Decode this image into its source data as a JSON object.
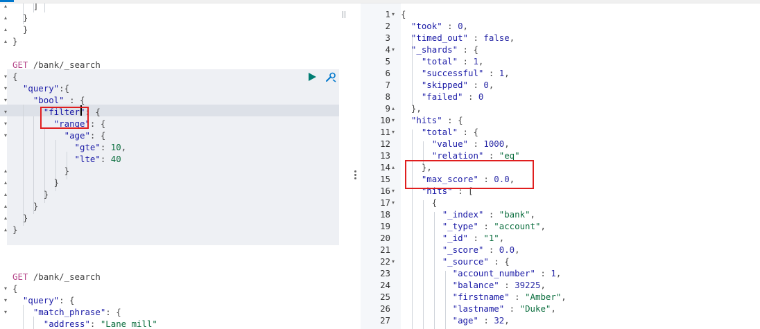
{
  "left_editor": {
    "lines": [
      {
        "fold": "▴",
        "parts": [
          [
            "",
            "    ]"
          ]
        ]
      },
      {
        "fold": "▴",
        "parts": [
          [
            "",
            "  }"
          ]
        ]
      },
      {
        "fold": "▴",
        "parts": [
          [
            "",
            "  }"
          ]
        ]
      },
      {
        "fold": "▴",
        "parts": [
          [
            "",
            "}"
          ]
        ]
      },
      {
        "fold": "",
        "parts": [
          [
            "",
            ""
          ]
        ]
      },
      {
        "fold": "",
        "parts": [
          [
            "kw",
            "GET"
          ],
          [
            "",
            " /bank/_search"
          ]
        ]
      },
      {
        "fold": "▾",
        "parts": [
          [
            "",
            "{"
          ]
        ]
      },
      {
        "fold": "▾",
        "parts": [
          [
            "",
            "  "
          ],
          [
            "s",
            "\"query\""
          ],
          [
            "",
            ":{"
          ]
        ]
      },
      {
        "fold": "▾",
        "parts": [
          [
            "",
            "    "
          ],
          [
            "s",
            "\"bool\""
          ],
          [
            "",
            " : {"
          ]
        ]
      },
      {
        "fold": "▾",
        "parts": [
          [
            "",
            "      "
          ],
          [
            "s",
            "\"filter\""
          ],
          [
            "",
            ": {"
          ]
        ]
      },
      {
        "fold": "▾",
        "parts": [
          [
            "",
            "        "
          ],
          [
            "s",
            "\"range\""
          ],
          [
            "",
            ": {"
          ]
        ]
      },
      {
        "fold": "▾",
        "parts": [
          [
            "",
            "          "
          ],
          [
            "s",
            "\"age\""
          ],
          [
            "",
            ": {"
          ]
        ]
      },
      {
        "fold": "",
        "parts": [
          [
            "",
            "            "
          ],
          [
            "s",
            "\"gte\""
          ],
          [
            "",
            ": "
          ],
          [
            "n",
            "10"
          ],
          [
            "",
            ","
          ]
        ]
      },
      {
        "fold": "",
        "parts": [
          [
            "",
            "            "
          ],
          [
            "s",
            "\"lte\""
          ],
          [
            "",
            ": "
          ],
          [
            "n",
            "40"
          ]
        ]
      },
      {
        "fold": "▴",
        "parts": [
          [
            "",
            "          }"
          ]
        ]
      },
      {
        "fold": "▴",
        "parts": [
          [
            "",
            "        }"
          ]
        ]
      },
      {
        "fold": "▴",
        "parts": [
          [
            "",
            "      }"
          ]
        ]
      },
      {
        "fold": "▴",
        "parts": [
          [
            "",
            "    }"
          ]
        ]
      },
      {
        "fold": "▴",
        "parts": [
          [
            "",
            "  }"
          ]
        ]
      },
      {
        "fold": "▴",
        "parts": [
          [
            "",
            "}"
          ]
        ]
      },
      {
        "fold": "",
        "parts": [
          [
            "",
            ""
          ]
        ]
      },
      {
        "fold": "",
        "parts": [
          [
            "",
            ""
          ]
        ]
      },
      {
        "fold": "",
        "parts": [
          [
            "",
            ""
          ]
        ]
      },
      {
        "fold": "",
        "parts": [
          [
            "kw",
            "GET"
          ],
          [
            "",
            " /bank/_search"
          ]
        ]
      },
      {
        "fold": "▾",
        "parts": [
          [
            "",
            "{"
          ]
        ]
      },
      {
        "fold": "▾",
        "parts": [
          [
            "",
            "  "
          ],
          [
            "s",
            "\"query\""
          ],
          [
            "",
            ": {"
          ]
        ]
      },
      {
        "fold": "▾",
        "parts": [
          [
            "",
            "    "
          ],
          [
            "s",
            "\"match_phrase\""
          ],
          [
            "",
            ": {"
          ]
        ]
      },
      {
        "fold": "",
        "parts": [
          [
            "",
            "      "
          ],
          [
            "s",
            "\"address\""
          ],
          [
            "",
            ": "
          ],
          [
            "n",
            "\"Lane mill\""
          ]
        ]
      }
    ]
  },
  "right_editor": {
    "lines": [
      {
        "n": "1",
        "fold": "▾",
        "parts": [
          [
            "",
            "{"
          ]
        ]
      },
      {
        "n": "2",
        "fold": "",
        "parts": [
          [
            "",
            "  "
          ],
          [
            "s",
            "\"took\""
          ],
          [
            "",
            " : "
          ],
          [
            "m",
            "0"
          ],
          [
            "",
            ","
          ]
        ]
      },
      {
        "n": "3",
        "fold": "",
        "parts": [
          [
            "",
            "  "
          ],
          [
            "s",
            "\"timed_out\""
          ],
          [
            "",
            " : "
          ],
          [
            "m",
            "false"
          ],
          [
            "",
            ","
          ]
        ]
      },
      {
        "n": "4",
        "fold": "▾",
        "parts": [
          [
            "",
            "  "
          ],
          [
            "s",
            "\"_shards\""
          ],
          [
            "",
            " : {"
          ]
        ]
      },
      {
        "n": "5",
        "fold": "",
        "parts": [
          [
            "",
            "    "
          ],
          [
            "s",
            "\"total\""
          ],
          [
            "",
            " : "
          ],
          [
            "m",
            "1"
          ],
          [
            "",
            ","
          ]
        ]
      },
      {
        "n": "6",
        "fold": "",
        "parts": [
          [
            "",
            "    "
          ],
          [
            "s",
            "\"successful\""
          ],
          [
            "",
            " : "
          ],
          [
            "m",
            "1"
          ],
          [
            "",
            ","
          ]
        ]
      },
      {
        "n": "7",
        "fold": "",
        "parts": [
          [
            "",
            "    "
          ],
          [
            "s",
            "\"skipped\""
          ],
          [
            "",
            " : "
          ],
          [
            "m",
            "0"
          ],
          [
            "",
            ","
          ]
        ]
      },
      {
        "n": "8",
        "fold": "",
        "parts": [
          [
            "",
            "    "
          ],
          [
            "s",
            "\"failed\""
          ],
          [
            "",
            " : "
          ],
          [
            "m",
            "0"
          ]
        ]
      },
      {
        "n": "9",
        "fold": "▴",
        "parts": [
          [
            "",
            "  },"
          ]
        ]
      },
      {
        "n": "10",
        "fold": "▾",
        "parts": [
          [
            "",
            "  "
          ],
          [
            "s",
            "\"hits\""
          ],
          [
            "",
            " : {"
          ]
        ]
      },
      {
        "n": "11",
        "fold": "▾",
        "parts": [
          [
            "",
            "    "
          ],
          [
            "s",
            "\"total\""
          ],
          [
            "",
            " : {"
          ]
        ]
      },
      {
        "n": "12",
        "fold": "",
        "parts": [
          [
            "",
            "      "
          ],
          [
            "s",
            "\"value\""
          ],
          [
            "",
            " : "
          ],
          [
            "m",
            "1000"
          ],
          [
            "",
            ","
          ]
        ]
      },
      {
        "n": "13",
        "fold": "",
        "parts": [
          [
            "",
            "      "
          ],
          [
            "s",
            "\"relation\""
          ],
          [
            "",
            " : "
          ],
          [
            "n",
            "\"eq\""
          ]
        ]
      },
      {
        "n": "14",
        "fold": "▴",
        "parts": [
          [
            "",
            "    },"
          ]
        ]
      },
      {
        "n": "15",
        "fold": "",
        "parts": [
          [
            "",
            "    "
          ],
          [
            "s",
            "\"max_score\""
          ],
          [
            "",
            " : "
          ],
          [
            "m",
            "0.0"
          ],
          [
            "",
            ","
          ]
        ]
      },
      {
        "n": "16",
        "fold": "▾",
        "parts": [
          [
            "",
            "    "
          ],
          [
            "s",
            "\"hits\""
          ],
          [
            "",
            " : ["
          ]
        ]
      },
      {
        "n": "17",
        "fold": "▾",
        "parts": [
          [
            "",
            "      {"
          ]
        ]
      },
      {
        "n": "18",
        "fold": "",
        "parts": [
          [
            "",
            "        "
          ],
          [
            "s",
            "\"_index\""
          ],
          [
            "",
            " : "
          ],
          [
            "n",
            "\"bank\""
          ],
          [
            "",
            ","
          ]
        ]
      },
      {
        "n": "19",
        "fold": "",
        "parts": [
          [
            "",
            "        "
          ],
          [
            "s",
            "\"_type\""
          ],
          [
            "",
            " : "
          ],
          [
            "n",
            "\"account\""
          ],
          [
            "",
            ","
          ]
        ]
      },
      {
        "n": "20",
        "fold": "",
        "parts": [
          [
            "",
            "        "
          ],
          [
            "s",
            "\"_id\""
          ],
          [
            "",
            " : "
          ],
          [
            "n",
            "\"1\""
          ],
          [
            "",
            ","
          ]
        ]
      },
      {
        "n": "21",
        "fold": "",
        "parts": [
          [
            "",
            "        "
          ],
          [
            "s",
            "\"_score\""
          ],
          [
            "",
            " : "
          ],
          [
            "m",
            "0.0"
          ],
          [
            "",
            ","
          ]
        ]
      },
      {
        "n": "22",
        "fold": "▾",
        "parts": [
          [
            "",
            "        "
          ],
          [
            "s",
            "\"_source\""
          ],
          [
            "",
            " : {"
          ]
        ]
      },
      {
        "n": "23",
        "fold": "",
        "parts": [
          [
            "",
            "          "
          ],
          [
            "s",
            "\"account_number\""
          ],
          [
            "",
            " : "
          ],
          [
            "m",
            "1"
          ],
          [
            "",
            ","
          ]
        ]
      },
      {
        "n": "24",
        "fold": "",
        "parts": [
          [
            "",
            "          "
          ],
          [
            "s",
            "\"balance\""
          ],
          [
            "",
            " : "
          ],
          [
            "m",
            "39225"
          ],
          [
            "",
            ","
          ]
        ]
      },
      {
        "n": "25",
        "fold": "",
        "parts": [
          [
            "",
            "          "
          ],
          [
            "s",
            "\"firstname\""
          ],
          [
            "",
            " : "
          ],
          [
            "n",
            "\"Amber\""
          ],
          [
            "",
            ","
          ]
        ]
      },
      {
        "n": "26",
        "fold": "",
        "parts": [
          [
            "",
            "          "
          ],
          [
            "s",
            "\"lastname\""
          ],
          [
            "",
            " : "
          ],
          [
            "n",
            "\"Duke\""
          ],
          [
            "",
            ","
          ]
        ]
      },
      {
        "n": "27",
        "fold": "",
        "parts": [
          [
            "",
            "          "
          ],
          [
            "s",
            "\"age\""
          ],
          [
            "",
            " : "
          ],
          [
            "m",
            "32"
          ],
          [
            "",
            ","
          ]
        ]
      }
    ]
  },
  "colors": {
    "string_key": "#1a1aa6",
    "method": "#b5478a",
    "value": "#0b6e3e",
    "highlight_box": "#e01e1e"
  },
  "icons": {
    "run": "play-icon",
    "settings": "wrench-icon"
  }
}
